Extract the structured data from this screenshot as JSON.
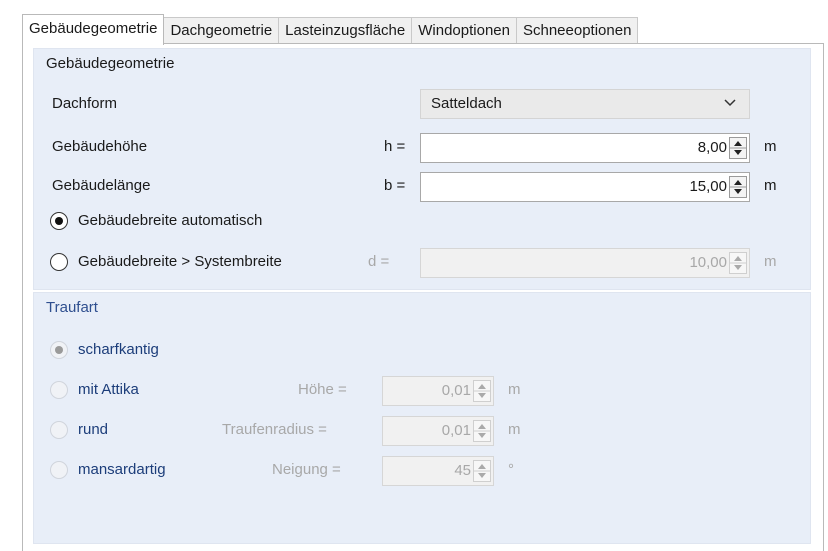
{
  "tabs": [
    "Gebäudegeometrie",
    "Dachgeometrie",
    "Lasteinzugsfläche",
    "Windoptionen",
    "Schneeoptionen"
  ],
  "geometry": {
    "legend": "Gebäudegeometrie",
    "roof_form": {
      "label": "Dachform",
      "value": "Satteldach"
    },
    "height": {
      "label": "Gebäudehöhe",
      "symbol": "h =",
      "value": "8,00",
      "unit": "m"
    },
    "length": {
      "label": "Gebäudelänge",
      "symbol": "b =",
      "value": "15,00",
      "unit": "m"
    },
    "width_auto": {
      "label": "Gebäudebreite automatisch",
      "checked": true
    },
    "width_system": {
      "label": "Gebäudebreite > Systembreite",
      "symbol": "d =",
      "value": "10,00",
      "unit": "m",
      "checked": false
    }
  },
  "eaves": {
    "legend": "Traufart",
    "options": [
      {
        "label": "scharfkantig",
        "checked": true
      },
      {
        "label": "mit Attika",
        "param_label": "Höhe =",
        "value": "0,01",
        "unit": "m"
      },
      {
        "label": "rund",
        "param_label": "Traufenradius =",
        "value": "0,01",
        "unit": "m"
      },
      {
        "label": "mansardartig",
        "param_label": "Neigung =",
        "value": "45",
        "unit": "°"
      }
    ]
  }
}
